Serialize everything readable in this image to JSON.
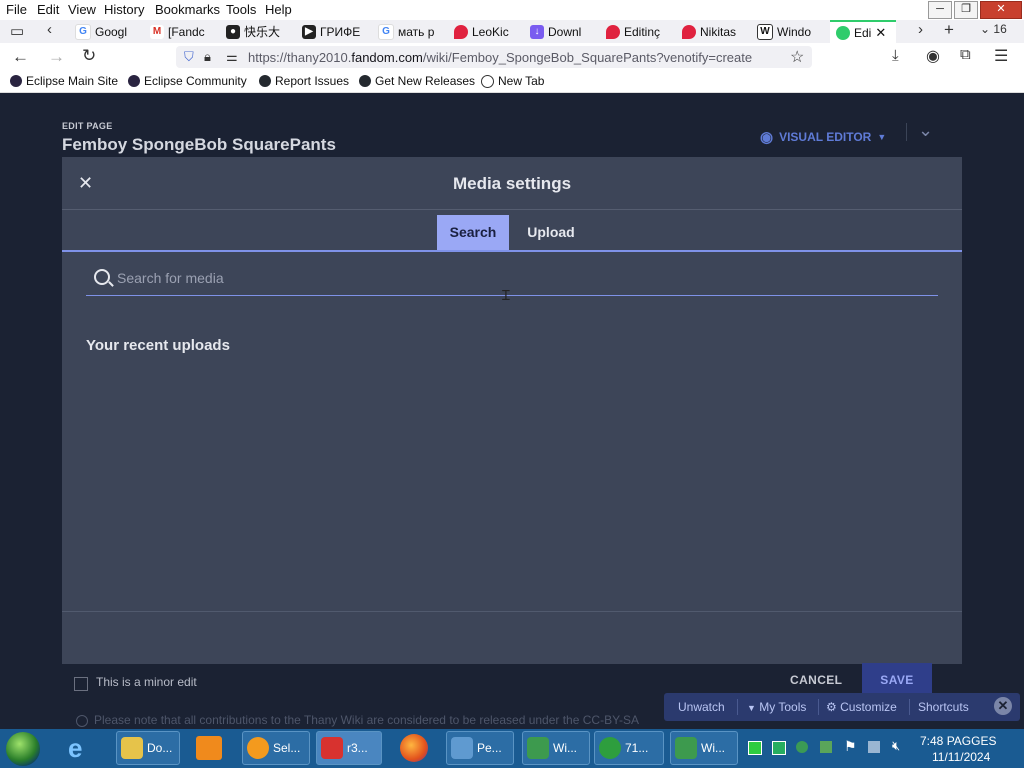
{
  "menubar": {
    "items": [
      "File",
      "Edit",
      "View",
      "History",
      "Bookmarks",
      "Tools",
      "Help"
    ]
  },
  "tabs": [
    {
      "label": "Googl",
      "icon": "google-icon"
    },
    {
      "label": "[Fandc",
      "icon": "gmail-icon"
    },
    {
      "label": "快乐大",
      "icon": "site-icon"
    },
    {
      "label": "ГРИФЕ",
      "icon": "youtube-icon"
    },
    {
      "label": "мать р",
      "icon": "google-icon"
    },
    {
      "label": "LeoKic",
      "icon": "fandom-icon"
    },
    {
      "label": "Downl",
      "icon": "download-icon"
    },
    {
      "label": "Editinç",
      "icon": "fandom-icon"
    },
    {
      "label": "Nikitas",
      "icon": "fandom-icon"
    },
    {
      "label": "Windo",
      "icon": "wiki-icon"
    },
    {
      "label": "Edi",
      "icon": "fandom-icon",
      "active": true
    }
  ],
  "tab_count": "16",
  "address": {
    "prefix": "https://thany2010.",
    "domain": "fandom.com",
    "path": "/wiki/Femboy_SpongeBob_SquarePants?venotify=create"
  },
  "bookmarks": [
    "Eclipse Main Site",
    "Eclipse Community",
    "Report Issues",
    "Get New Releases",
    "New Tab"
  ],
  "page": {
    "edit_label": "EDIT PAGE",
    "title": "Femboy SpongeBob SquarePants",
    "visual_editor": "VISUAL EDITOR"
  },
  "modal": {
    "close": "✕",
    "title": "Media settings",
    "tabs": [
      "Search",
      "Upload"
    ],
    "search_placeholder": "Search for media",
    "recent_heading": "Your recent uploads"
  },
  "footer": {
    "minor_edit": "This is a minor edit",
    "cancel": "CANCEL",
    "save": "SAVE",
    "notice": "Please note that all contributions to the Thany Wiki are considered to be released under the CC-BY-SA"
  },
  "fandom_toolbar": {
    "items": [
      "Unwatch",
      "My Tools",
      "Customize",
      "Shortcuts"
    ]
  },
  "taskbar": {
    "buttons": [
      "Do...",
      "Sel...",
      "r3...",
      "Pe...",
      "Wi...",
      "71...",
      "Wi..."
    ],
    "clock_time": "7:48 PAGGES",
    "clock_date": "11/11/2024"
  }
}
